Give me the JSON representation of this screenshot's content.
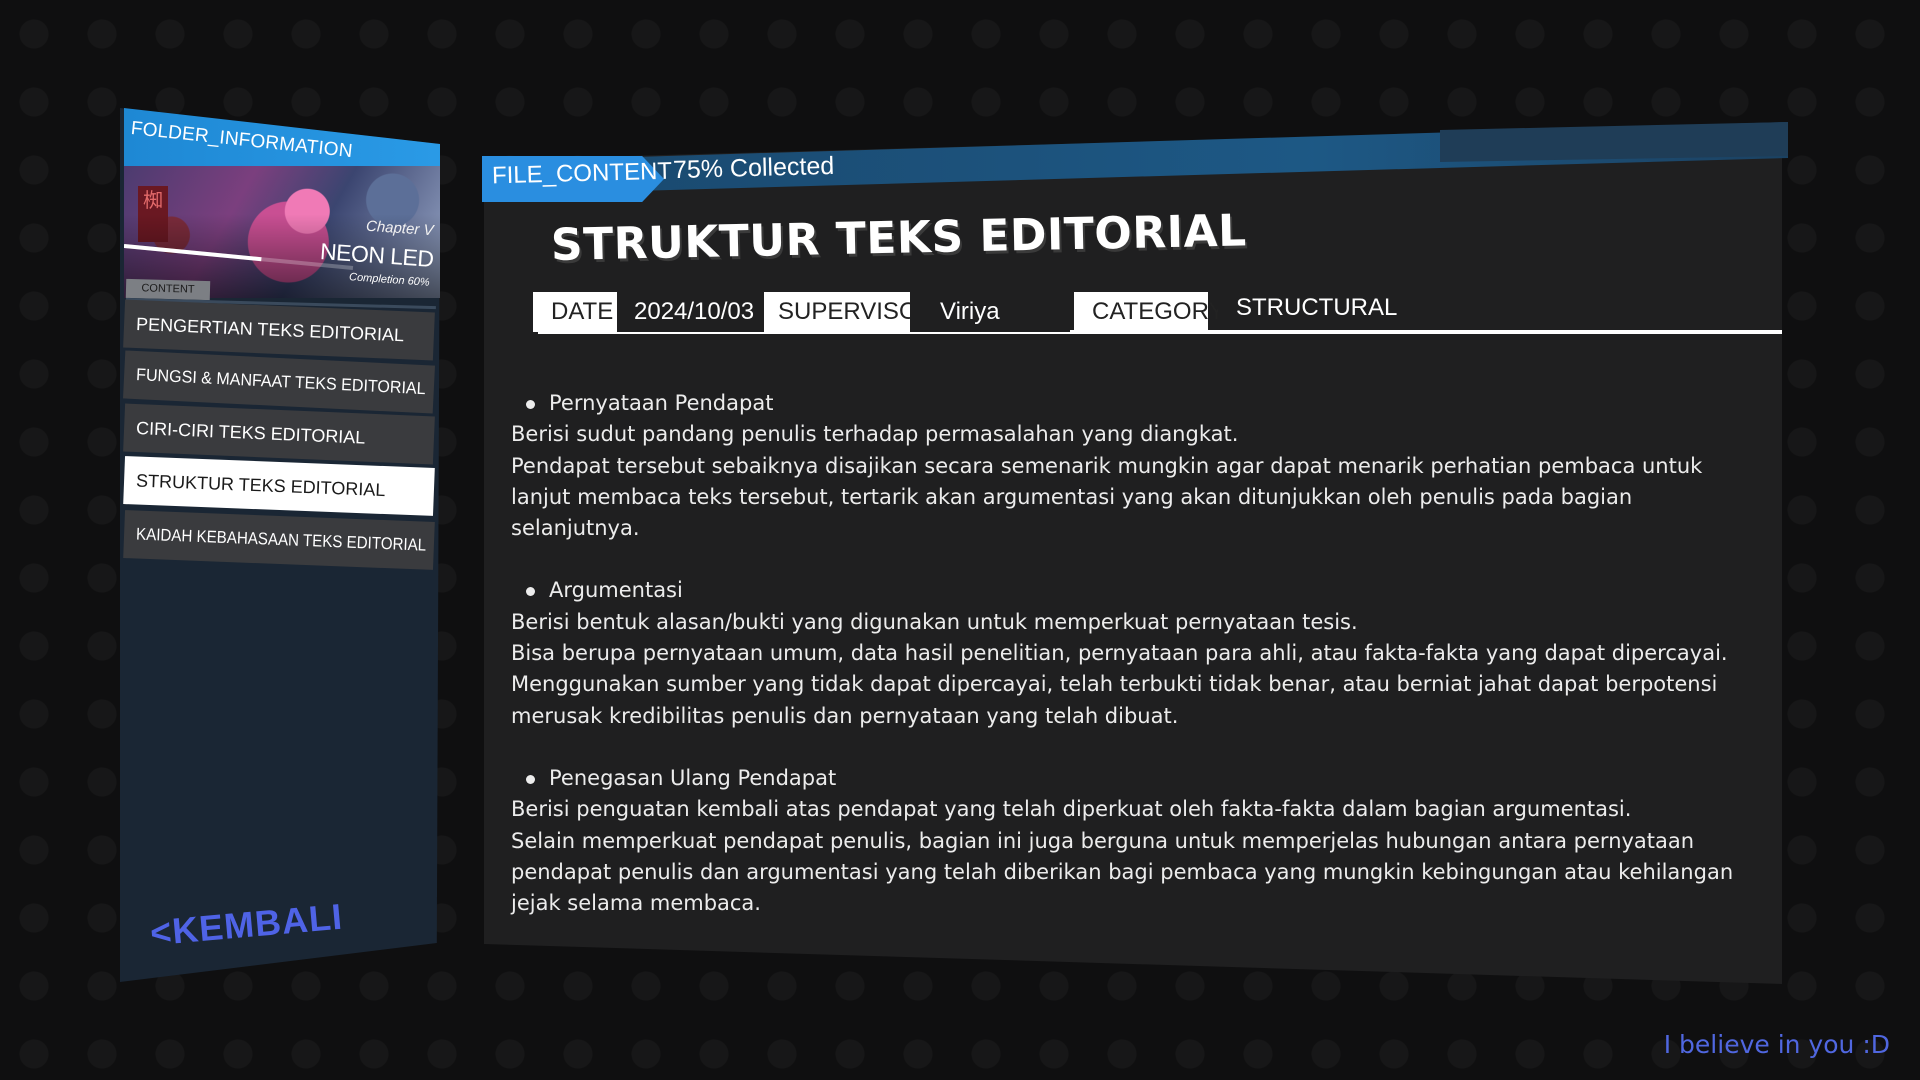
{
  "sidebar": {
    "folder_title": "FOLDER_INFORMATION",
    "art_sign": "椥",
    "chapter_label": "Chapter V",
    "chapter_name": "NEON LED",
    "completion_text": "Completion 60%",
    "completion_value": 0.6,
    "content_tag": "CONTENT",
    "items": [
      {
        "label": "PENGERTIAN TEKS EDITORIAL"
      },
      {
        "label": "FUNGSI & MANFAAT TEKS EDITORIAL"
      },
      {
        "label": "CIRI-CIRI TEKS EDITORIAL"
      },
      {
        "label": "STRUKTUR TEKS EDITORIAL"
      },
      {
        "label": "KAIDAH KEBAHASAAN TEKS EDITORIAL"
      }
    ],
    "active_index": 3,
    "back_label": "<KEMBALI"
  },
  "header": {
    "file_tag": "FILE_CONTENT",
    "collected": "75% Collected",
    "collected_value": 0.75,
    "title": "STRUKTUR TEKS EDITORIAL"
  },
  "meta": {
    "date_label": "DATE",
    "date_value": "2024/10/03",
    "supervisor_label": "SUPERVISOR",
    "supervisor_value": "Viriya",
    "category_label": "CATEGORY",
    "category_value": "STRUCTURAL"
  },
  "content": {
    "sections": [
      {
        "heading": "Pernyataan Pendapat",
        "paragraphs": [
          "Berisi sudut pandang penulis terhadap permasalahan yang diangkat.",
          "Pendapat tersebut sebaiknya disajikan secara semenarik mungkin agar dapat menarik perhatian pembaca untuk lanjut membaca teks tersebut, tertarik akan argumentasi yang akan ditunjukkan oleh penulis pada bagian selanjutnya."
        ]
      },
      {
        "heading": "Argumentasi",
        "paragraphs": [
          "Berisi bentuk alasan/bukti yang digunakan untuk memperkuat pernyataan tesis.",
          "Bisa berupa pernyataan umum, data hasil penelitian, pernyataan para ahli, atau fakta-fakta yang dapat dipercayai.",
          "Menggunakan sumber yang tidak dapat dipercayai, telah terbukti tidak benar, atau berniat jahat dapat berpotensi merusak kredibilitas penulis dan pernyataan yang telah dibuat."
        ]
      },
      {
        "heading": "Penegasan Ulang Pendapat",
        "paragraphs": [
          "Berisi penguatan kembali atas pendapat yang telah diperkuat oleh fakta-fakta dalam bagian argumentasi.",
          "Selain memperkuat pendapat penulis, bagian ini juga berguna untuk memperjelas hubungan antara pernyataan pendapat penulis dan argumentasi yang telah diberikan bagi pembaca yang mungkin kebingungan atau kehilangan jejak selama membaca."
        ]
      }
    ]
  },
  "footer": {
    "text": "I believe in you :D"
  },
  "colors": {
    "accent_blue": "#2a8ee0",
    "back_button": "#4f63e6",
    "footer_text": "#5067e0",
    "sidebar_bg": "#1a2634",
    "panel_bg": "#1f1f20"
  }
}
